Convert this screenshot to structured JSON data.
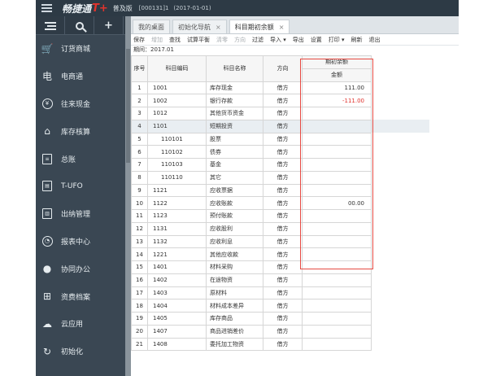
{
  "header": {
    "brand": "畅捷通",
    "brand_suffix": "T+",
    "edition": "普及版",
    "account": "[000131]1",
    "date": "(2017-01-01)"
  },
  "sidebar": {
    "tools": [
      "menu-icon",
      "search-icon",
      "plus-icon"
    ],
    "items": [
      {
        "label": "订货商城",
        "icon": "cart-icon",
        "glyph": "🛒"
      },
      {
        "label": "电商通",
        "icon": "shop-icon",
        "glyph": "电"
      },
      {
        "label": "往来现金",
        "icon": "yuan-icon",
        "glyph": "¥"
      },
      {
        "label": "库存核算",
        "icon": "warehouse-icon",
        "glyph": "⌂"
      },
      {
        "label": "总账",
        "icon": "ledger-icon",
        "glyph": "≡"
      },
      {
        "label": "T-UFO",
        "icon": "report-icon",
        "glyph": "▤"
      },
      {
        "label": "出纳管理",
        "icon": "cashier-icon",
        "glyph": "▥"
      },
      {
        "label": "报表中心",
        "icon": "chart-icon",
        "glyph": "◔"
      },
      {
        "label": "协同办公",
        "icon": "collab-icon",
        "glyph": "●"
      },
      {
        "label": "资费档案",
        "icon": "archive-icon",
        "glyph": "⊞"
      },
      {
        "label": "云应用",
        "icon": "cloud-icon",
        "glyph": "☁"
      },
      {
        "label": "初始化",
        "icon": "init-icon",
        "glyph": "↻"
      }
    ]
  },
  "tabs": [
    {
      "label": "我的桌面",
      "closable": false
    },
    {
      "label": "初始化导航",
      "closable": true
    },
    {
      "label": "科目期初余额",
      "closable": true
    }
  ],
  "toolbar": [
    {
      "label": "保存",
      "enabled": true
    },
    {
      "label": "增加",
      "enabled": false
    },
    {
      "label": "查找",
      "enabled": true
    },
    {
      "label": "试算平衡",
      "enabled": true
    },
    {
      "label": "清零",
      "enabled": false
    },
    {
      "label": "方向",
      "enabled": false
    },
    {
      "label": "过滤",
      "enabled": true
    },
    {
      "label": "导入 ▾",
      "enabled": true
    },
    {
      "label": "导出",
      "enabled": true
    },
    {
      "label": "设置",
      "enabled": true
    },
    {
      "label": "打印 ▾",
      "enabled": true
    },
    {
      "label": "刷新",
      "enabled": true
    },
    {
      "label": "退出",
      "enabled": true
    }
  ],
  "period": "期间：2017.01",
  "table": {
    "headers": {
      "seq": "序号",
      "code": "科目编码",
      "name": "科目名称",
      "direction": "方向",
      "balance_group": "期初余额",
      "amount": "金额"
    },
    "rows": [
      {
        "seq": "1",
        "code": "1001",
        "name": "库存现金",
        "dir": "借方",
        "amount": "111.00",
        "sub": false,
        "neg": false
      },
      {
        "seq": "2",
        "code": "1002",
        "name": "银行存款",
        "dir": "借方",
        "amount": "-111.00",
        "sub": false,
        "neg": true
      },
      {
        "seq": "3",
        "code": "1012",
        "name": "其他货币资金",
        "dir": "借方",
        "amount": "",
        "sub": false,
        "neg": false
      },
      {
        "seq": "4",
        "code": "1101",
        "name": "短期投资",
        "dir": "借方",
        "amount": "",
        "sub": false,
        "neg": false,
        "selected": true
      },
      {
        "seq": "5",
        "code": "110101",
        "name": "股票",
        "dir": "借方",
        "amount": "",
        "sub": true,
        "neg": false
      },
      {
        "seq": "6",
        "code": "110102",
        "name": "债券",
        "dir": "借方",
        "amount": "",
        "sub": true,
        "neg": false
      },
      {
        "seq": "7",
        "code": "110103",
        "name": "基金",
        "dir": "借方",
        "amount": "",
        "sub": true,
        "neg": false
      },
      {
        "seq": "8",
        "code": "110110",
        "name": "其它",
        "dir": "借方",
        "amount": "",
        "sub": true,
        "neg": false
      },
      {
        "seq": "9",
        "code": "1121",
        "name": "应收票据",
        "dir": "借方",
        "amount": "",
        "sub": false,
        "neg": false
      },
      {
        "seq": "10",
        "code": "1122",
        "name": "应收账款",
        "dir": "借方",
        "amount": "00.00",
        "sub": false,
        "neg": false
      },
      {
        "seq": "11",
        "code": "1123",
        "name": "预付账款",
        "dir": "借方",
        "amount": "",
        "sub": false,
        "neg": false
      },
      {
        "seq": "12",
        "code": "1131",
        "name": "应收股利",
        "dir": "借方",
        "amount": "",
        "sub": false,
        "neg": false
      },
      {
        "seq": "13",
        "code": "1132",
        "name": "应收利息",
        "dir": "借方",
        "amount": "",
        "sub": false,
        "neg": false
      },
      {
        "seq": "14",
        "code": "1221",
        "name": "其他应收款",
        "dir": "借方",
        "amount": "",
        "sub": false,
        "neg": false
      },
      {
        "seq": "15",
        "code": "1401",
        "name": "材料采购",
        "dir": "借方",
        "amount": "",
        "sub": false,
        "neg": false
      },
      {
        "seq": "16",
        "code": "1402",
        "name": "在途物资",
        "dir": "借方",
        "amount": "",
        "sub": false,
        "neg": false
      },
      {
        "seq": "17",
        "code": "1403",
        "name": "原材料",
        "dir": "借方",
        "amount": "",
        "sub": false,
        "neg": false
      },
      {
        "seq": "18",
        "code": "1404",
        "name": "材料成本差异",
        "dir": "借方",
        "amount": "",
        "sub": false,
        "neg": false
      },
      {
        "seq": "19",
        "code": "1405",
        "name": "库存商品",
        "dir": "借方",
        "amount": "",
        "sub": false,
        "neg": false
      },
      {
        "seq": "20",
        "code": "1407",
        "name": "商品进销差价",
        "dir": "借方",
        "amount": "",
        "sub": false,
        "neg": false
      },
      {
        "seq": "21",
        "code": "1408",
        "name": "委托加工物资",
        "dir": "借方",
        "amount": "",
        "sub": false,
        "neg": false
      }
    ]
  },
  "colors": {
    "sidebar_bg": "#3a4753",
    "topbar_bg": "#2d3a45",
    "highlight_border": "#e64a42",
    "negative_amount": "#e0312c"
  }
}
